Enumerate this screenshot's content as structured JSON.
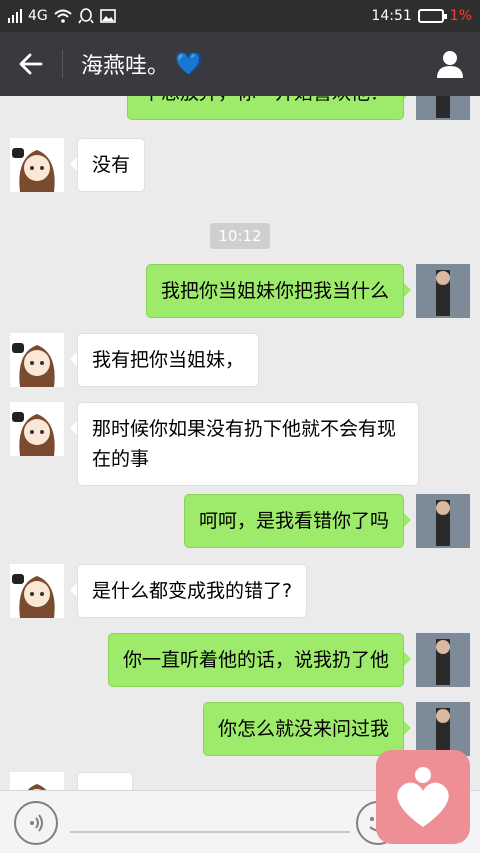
{
  "status_bar": {
    "network": "4G",
    "time": "14:51",
    "battery_percent": "1%",
    "icons": [
      "signal-icon",
      "wifi-icon",
      "qq-icon",
      "image-icon",
      "battery-icon"
    ]
  },
  "header": {
    "title": "海燕哇。",
    "title_emoji": "💙",
    "back_icon": "back-arrow-icon",
    "profile_icon": "person-icon"
  },
  "messages": [
    {
      "side": "right",
      "text": "不想放弃，你一开始喜欢他？"
    },
    {
      "side": "left",
      "text": "没有"
    },
    {
      "side": "time",
      "text": "10:12"
    },
    {
      "side": "right",
      "text": "我把你当姐妹你把我当什么"
    },
    {
      "side": "left",
      "text": "我有把你当姐妹，"
    },
    {
      "side": "left",
      "text": "那时候你如果没有扔下他就不会有现在的事"
    },
    {
      "side": "right",
      "text": "呵呵，是我看错你了吗"
    },
    {
      "side": "left",
      "text": "是什么都变成我的错了?"
    },
    {
      "side": "right",
      "text": "你一直听着他的话，说我扔了他"
    },
    {
      "side": "right",
      "text": "你怎么就没来问过我"
    },
    {
      "side": "left",
      "text": ""
    }
  ],
  "input_bar": {
    "voice_icon": "voice-icon",
    "emoji_icon": "emoji-icon"
  },
  "floating_button": {
    "icon": "heart-icon"
  },
  "colors": {
    "header_bg": "#393a3f",
    "status_bg": "#2e2e2e",
    "chat_bg": "#ebebeb",
    "sent_bubble": "#9eea6a",
    "received_bubble": "#ffffff",
    "battery_low": "#ff3b30",
    "float_button": "#ee8f96"
  }
}
